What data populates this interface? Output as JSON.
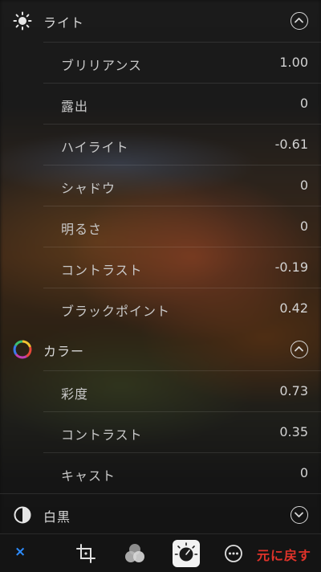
{
  "sections": {
    "light": {
      "title": "ライト",
      "icon": "sun-icon",
      "expanded": true,
      "rows": [
        {
          "label": "ブリリアンス",
          "value": "1.00"
        },
        {
          "label": "露出",
          "value": "0"
        },
        {
          "label": "ハイライト",
          "value": "-0.61"
        },
        {
          "label": "シャドウ",
          "value": "0"
        },
        {
          "label": "明るさ",
          "value": "0"
        },
        {
          "label": "コントラスト",
          "value": "-0.19"
        },
        {
          "label": "ブラックポイント",
          "value": "0.42"
        }
      ]
    },
    "color": {
      "title": "カラー",
      "icon": "color-wheel-icon",
      "expanded": true,
      "rows": [
        {
          "label": "彩度",
          "value": "0.73"
        },
        {
          "label": "コントラスト",
          "value": "0.35"
        },
        {
          "label": "キャスト",
          "value": "0"
        }
      ]
    },
    "bw": {
      "title": "白黒",
      "icon": "half-circle-icon",
      "expanded": false
    }
  },
  "toolbar": {
    "cancel_label": "×",
    "revert_label": "元に戻す",
    "tools": [
      "crop-icon",
      "filters-icon",
      "adjust-dial-icon",
      "more-icon"
    ],
    "active_tool": "adjust-dial-icon"
  },
  "colors": {
    "cancel": "#2d8cff",
    "revert": "#e0332a",
    "text": "#d2d2d2"
  }
}
